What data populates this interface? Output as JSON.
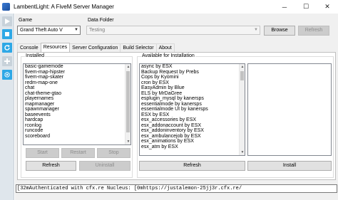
{
  "window": {
    "title": "LambentLight: A FiveM Server Manager",
    "controls": {
      "minimize": "─",
      "maximize": "☐",
      "close": "✕"
    }
  },
  "toolbar": {
    "buttons": [
      {
        "icon": "play-icon",
        "color": "#c8d2da"
      },
      {
        "icon": "stop-icon",
        "color": "#2ea8e6"
      },
      {
        "icon": "refresh-icon",
        "color": "#2ea8e6"
      },
      {
        "icon": "add-icon",
        "color": "#c8d2da"
      },
      {
        "icon": "settings-gear-icon",
        "color": "#2ea8e6"
      }
    ]
  },
  "game": {
    "label": "Game",
    "value": "Grand Theft Auto V"
  },
  "data_folder": {
    "label": "Data Folder",
    "value": "Testing",
    "browse_label": "Browse",
    "refresh_label": "Refresh"
  },
  "tabs": [
    {
      "label": "Console",
      "active": false
    },
    {
      "label": "Resources",
      "active": true
    },
    {
      "label": "Server Configuration",
      "active": false
    },
    {
      "label": "Build Selector",
      "active": false
    },
    {
      "label": "About",
      "active": false
    }
  ],
  "installed": {
    "title": "Installed",
    "items": [
      "basic-gamemode",
      "fivem-map-hipster",
      "fivem-map-skater",
      "redm-map-one",
      "chat",
      "chat-theme-gtao",
      "playernames",
      "mapmanager",
      "spawnmanager",
      "baseevents",
      "hardcap",
      "rconlog",
      "runcode",
      "scoreboard"
    ],
    "start_label": "Start",
    "restart_label": "Restart",
    "stop_label": "Stop",
    "refresh_label": "Refresh",
    "uninstall_label": "Uninstall"
  },
  "available": {
    "title": "Available for Installation",
    "items": [
      "async by ESX",
      "Backup Request by Prebs",
      "Cops by Kyomini",
      "cron by ESX",
      "EasyAdmin by Blue",
      "ELS by MrDaGree",
      "esplugin_mysql by kanersps",
      "essentialmode by kanersps",
      "essentialmode UI by kanersps",
      "ESX by ESX",
      "esx_accessories by ESX",
      "esx_addonaccount by ESX",
      "esx_addoninventory by ESX",
      "esx_ambulancejob by ESX",
      "esx_animations by ESX",
      "esx_atm by ESX"
    ],
    "refresh_label": "Refresh",
    "install_label": "Install"
  },
  "log": {
    "line": "[32mAuthenticated with cfx.re Nucleus: [0mhttps://justalemon-25jj3r.cfx.re/"
  }
}
